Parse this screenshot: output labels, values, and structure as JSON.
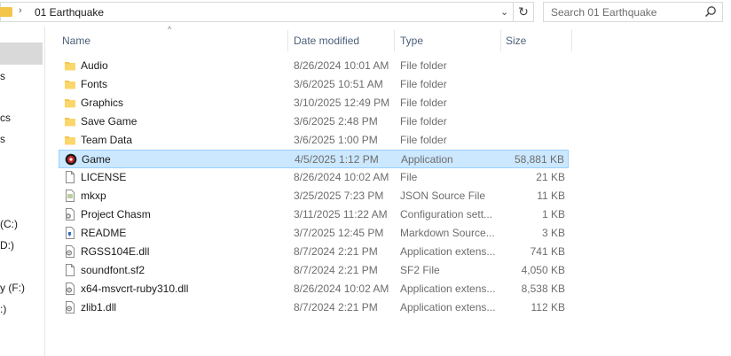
{
  "address": {
    "separator": "›",
    "path": "01 Earthquake",
    "dropdown": "⌄",
    "refresh": "↻"
  },
  "search": {
    "placeholder": "Search 01 Earthquake"
  },
  "nav": {
    "fragments": [
      "s",
      "cs",
      "s",
      "(C:)",
      "D:)",
      "y (F:)",
      ":)"
    ]
  },
  "columns": {
    "name": "Name",
    "date": "Date modified",
    "type": "Type",
    "size": "Size"
  },
  "sort_indicator": "^",
  "files": [
    {
      "name": "Audio",
      "date": "8/26/2024 10:01 AM",
      "type": "File folder",
      "size": "",
      "icon": "folder"
    },
    {
      "name": "Fonts",
      "date": "3/6/2025 10:51 AM",
      "type": "File folder",
      "size": "",
      "icon": "folder"
    },
    {
      "name": "Graphics",
      "date": "3/10/2025 12:49 PM",
      "type": "File folder",
      "size": "",
      "icon": "folder"
    },
    {
      "name": "Save Game",
      "date": "3/6/2025 2:48 PM",
      "type": "File folder",
      "size": "",
      "icon": "folder"
    },
    {
      "name": "Team Data",
      "date": "3/6/2025 1:00 PM",
      "type": "File folder",
      "size": "",
      "icon": "folder"
    },
    {
      "name": "Game",
      "date": "4/5/2025 1:12 PM",
      "type": "Application",
      "size": "58,881 KB",
      "icon": "app",
      "selected": true
    },
    {
      "name": "LICENSE",
      "date": "8/26/2024 10:02 AM",
      "type": "File",
      "size": "21 KB",
      "icon": "file"
    },
    {
      "name": "mkxp",
      "date": "3/25/2025 7:23 PM",
      "type": "JSON Source File",
      "size": "11 KB",
      "icon": "json"
    },
    {
      "name": "Project Chasm",
      "date": "3/11/2025 11:22 AM",
      "type": "Configuration sett...",
      "size": "1 KB",
      "icon": "config"
    },
    {
      "name": "README",
      "date": "3/7/2025 12:45 PM",
      "type": "Markdown Source...",
      "size": "3 KB",
      "icon": "markdown"
    },
    {
      "name": "RGSS104E.dll",
      "date": "8/7/2024 2:21 PM",
      "type": "Application extens...",
      "size": "741 KB",
      "icon": "dll"
    },
    {
      "name": "soundfont.sf2",
      "date": "8/7/2024 2:21 PM",
      "type": "SF2 File",
      "size": "4,050 KB",
      "icon": "file"
    },
    {
      "name": "x64-msvcrt-ruby310.dll",
      "date": "8/26/2024 10:02 AM",
      "type": "Application extens...",
      "size": "8,538 KB",
      "icon": "dll"
    },
    {
      "name": "zlib1.dll",
      "date": "8/7/2024 2:21 PM",
      "type": "Application extens...",
      "size": "112 KB",
      "icon": "dll"
    }
  ]
}
